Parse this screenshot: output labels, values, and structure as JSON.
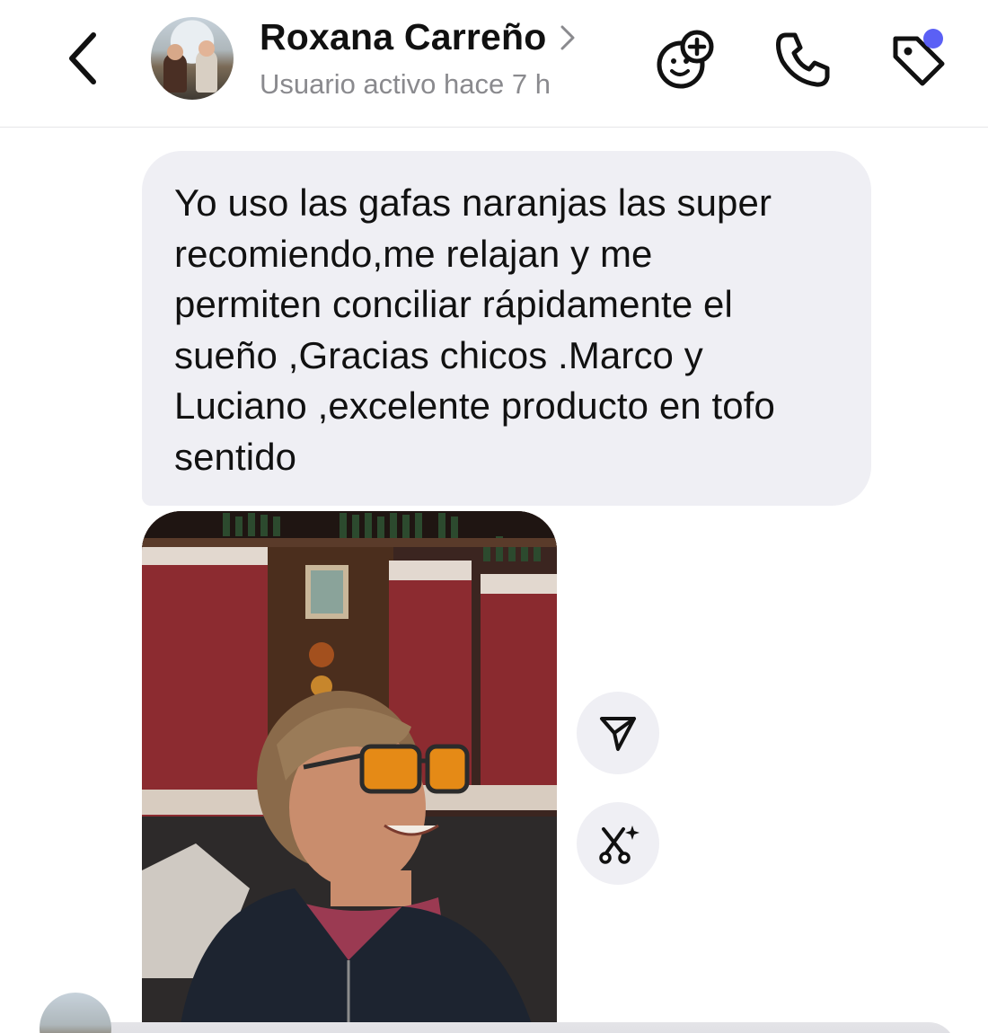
{
  "header": {
    "back_icon": "chevron-left-icon",
    "contact_name": "Roxana Carreño",
    "status": "Usuario activo hace 7 h",
    "actions": [
      {
        "name": "add-friend-face-icon"
      },
      {
        "name": "phone-icon"
      },
      {
        "name": "tag-icon"
      }
    ],
    "notification_dot_color": "#5b60f5"
  },
  "message": {
    "text": "Yo uso las gafas naranjas las super\nrecomiendo,me relajan y me\npermiten conciliar rápidamente el\nsueño ,Gracias chicos .Marco y\nLuciano ,excelente producto en tofo\nsentido",
    "bubble_color": "#efeff4"
  },
  "photo": {
    "subject": "woman-with-orange-glasses-photo"
  },
  "photo_actions": [
    {
      "name": "share-send-icon"
    },
    {
      "name": "magic-edit-icon"
    }
  ]
}
